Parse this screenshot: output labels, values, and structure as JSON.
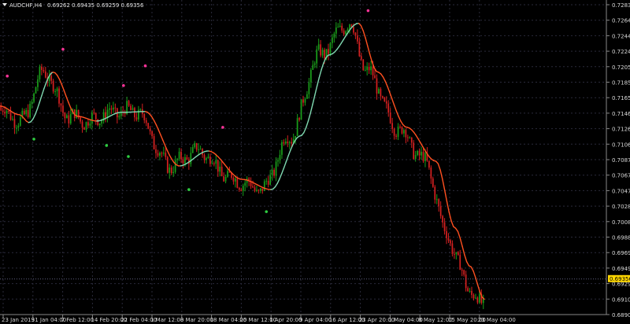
{
  "header": {
    "symbol_label": "AUDCHF,H4",
    "ohlc_label": "0.69262 0.69435 0.69259 0.69356"
  },
  "colors": {
    "background": "#000000",
    "grid": "#2a2a3a",
    "axis_text": "#d9d9d9",
    "bull_candle": "#1a9e1a",
    "bear_candle": "#d42020",
    "ma_up": "#7fd8b0",
    "ma_down": "#ff5020",
    "dot_up": "#2ecc40",
    "dot_down": "#ff3399",
    "price_tag_bg": "#ffd700",
    "price_tag_text": "#000000",
    "price_line": "#606080"
  },
  "chart_data": {
    "type": "line",
    "ylim": [
      0.68905,
      0.72835
    ],
    "y_ticks": [
      "0.72835",
      "0.72640",
      "0.72445",
      "0.72245",
      "0.72050",
      "0.71850",
      "0.71655",
      "0.71460",
      "0.71265",
      "0.71065",
      "0.70870",
      "0.70675",
      "0.70475",
      "0.70280",
      "0.70085",
      "0.69885",
      "0.69690",
      "0.69495",
      "0.69295",
      "0.69100",
      "0.68905"
    ],
    "x_ticks": [
      "23 Jan 2019",
      "31 Jan 04:00",
      "7 Feb 12:00",
      "14 Feb 20:00",
      "22 Feb 04:00",
      "1 Mar 12:00",
      "8 Mar 20:00",
      "18 Mar 04:00",
      "25 Mar 12:00",
      "1 Apr 20:00",
      "9 Apr 04:00",
      "16 Apr 12:00",
      "23 Apr 20:00",
      "1 May 04:00",
      "8 May 12:00",
      "15 May 20:00",
      "23 May 04:00"
    ],
    "current_price": "0.69356",
    "moving_average": [
      {
        "x": 0.0,
        "y": 0.7155
      },
      {
        "x": 0.04,
        "y": 0.7144
      },
      {
        "x": 0.06,
        "y": 0.7134
      },
      {
        "x": 0.11,
        "y": 0.7198
      },
      {
        "x": 0.16,
        "y": 0.7142
      },
      {
        "x": 0.2,
        "y": 0.7136
      },
      {
        "x": 0.25,
        "y": 0.7147
      },
      {
        "x": 0.3,
        "y": 0.7148
      },
      {
        "x": 0.37,
        "y": 0.7079
      },
      {
        "x": 0.43,
        "y": 0.7098
      },
      {
        "x": 0.5,
        "y": 0.7062
      },
      {
        "x": 0.56,
        "y": 0.7049
      },
      {
        "x": 0.62,
        "y": 0.7117
      },
      {
        "x": 0.68,
        "y": 0.722
      },
      {
        "x": 0.74,
        "y": 0.726
      },
      {
        "x": 0.78,
        "y": 0.7198
      },
      {
        "x": 0.84,
        "y": 0.7128
      },
      {
        "x": 0.9,
        "y": 0.7085
      },
      {
        "x": 0.94,
        "y": 0.7
      },
      {
        "x": 0.97,
        "y": 0.6952
      },
      {
        "x": 1.0,
        "y": 0.691
      }
    ],
    "signal_dots_up": [
      {
        "x": 0.07,
        "y": 0.7113
      },
      {
        "x": 0.22,
        "y": 0.7105
      },
      {
        "x": 0.265,
        "y": 0.7091
      },
      {
        "x": 0.39,
        "y": 0.7049
      },
      {
        "x": 0.55,
        "y": 0.7021
      }
    ],
    "signal_dots_down": [
      {
        "x": 0.015,
        "y": 0.7193
      },
      {
        "x": 0.13,
        "y": 0.7227
      },
      {
        "x": 0.255,
        "y": 0.7181
      },
      {
        "x": 0.3,
        "y": 0.7206
      },
      {
        "x": 0.46,
        "y": 0.7128
      },
      {
        "x": 0.76,
        "y": 0.7276
      }
    ]
  }
}
